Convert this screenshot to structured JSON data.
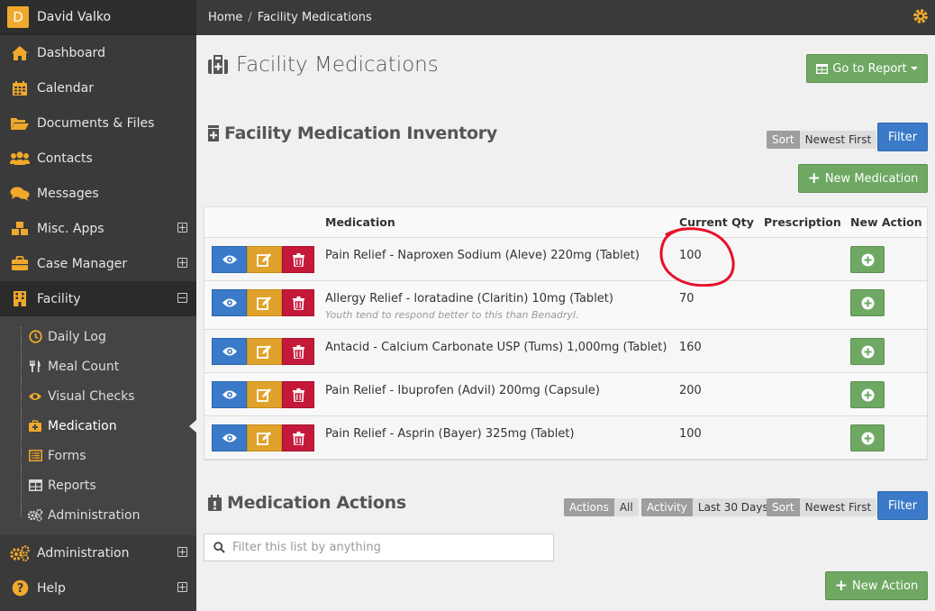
{
  "user": {
    "initial": "D",
    "name": "David Valko"
  },
  "nav": {
    "dashboard": "Dashboard",
    "calendar": "Calendar",
    "documents": "Documents & Files",
    "contacts": "Contacts",
    "messages": "Messages",
    "misc": "Misc. Apps",
    "case_manager": "Case Manager",
    "facility": "Facility",
    "administration": "Administration",
    "help": "Help"
  },
  "subnav": {
    "daily_log": "Daily Log",
    "meal_count": "Meal Count",
    "visual_checks": "Visual Checks",
    "medication": "Medication",
    "forms": "Forms",
    "reports": "Reports",
    "administration": "Administration"
  },
  "breadcrumb": {
    "home": "Home",
    "sep": "/",
    "current": "Facility Medications"
  },
  "page": {
    "title": "Facility Medications",
    "go_to_report": "Go to Report"
  },
  "inventory": {
    "title": "Facility Medication Inventory",
    "sort_key": "Sort",
    "sort_value": "Newest First",
    "filter_label": "Filter",
    "new_medication": "New Medication",
    "headers": {
      "medication": "Medication",
      "current_qty": "Current Qty",
      "prescription": "Prescription",
      "new_action": "New Action"
    },
    "rows": [
      {
        "name": "Pain Relief - Naproxen Sodium (Aleve) 220mg (Tablet)",
        "note": "",
        "qty": "100",
        "prescription": ""
      },
      {
        "name": "Allergy Relief - loratadine (Claritin) 10mg (Tablet)",
        "note": "Youth tend to respond better to this than Benadryl.",
        "qty": "70",
        "prescription": ""
      },
      {
        "name": "Antacid - Calcium Carbonate USP (Tums) 1,000mg (Tablet)",
        "note": "",
        "qty": "160",
        "prescription": ""
      },
      {
        "name": "Pain Relief - Ibuprofen (Advil) 200mg (Capsule)",
        "note": "",
        "qty": "200",
        "prescription": ""
      },
      {
        "name": "Pain Relief - Asprin (Bayer) 325mg (Tablet)",
        "note": "",
        "qty": "100",
        "prescription": ""
      }
    ]
  },
  "actions_section": {
    "title": "Medication Actions",
    "actions_key": "Actions",
    "actions_value": "All",
    "activity_key": "Activity",
    "activity_value": "Last 30 Days",
    "sort_key": "Sort",
    "sort_value": "Newest First",
    "filter_label": "Filter",
    "search_placeholder": "Filter this list by anything",
    "new_action": "New Action"
  },
  "colors": {
    "accent": "#f0a92d",
    "sidebar": "#3a3a3a",
    "primary": "#3a7ac8",
    "success": "#6ea863",
    "warning": "#e0a22a",
    "danger": "#c5193a",
    "annotation": "#e8102a"
  }
}
